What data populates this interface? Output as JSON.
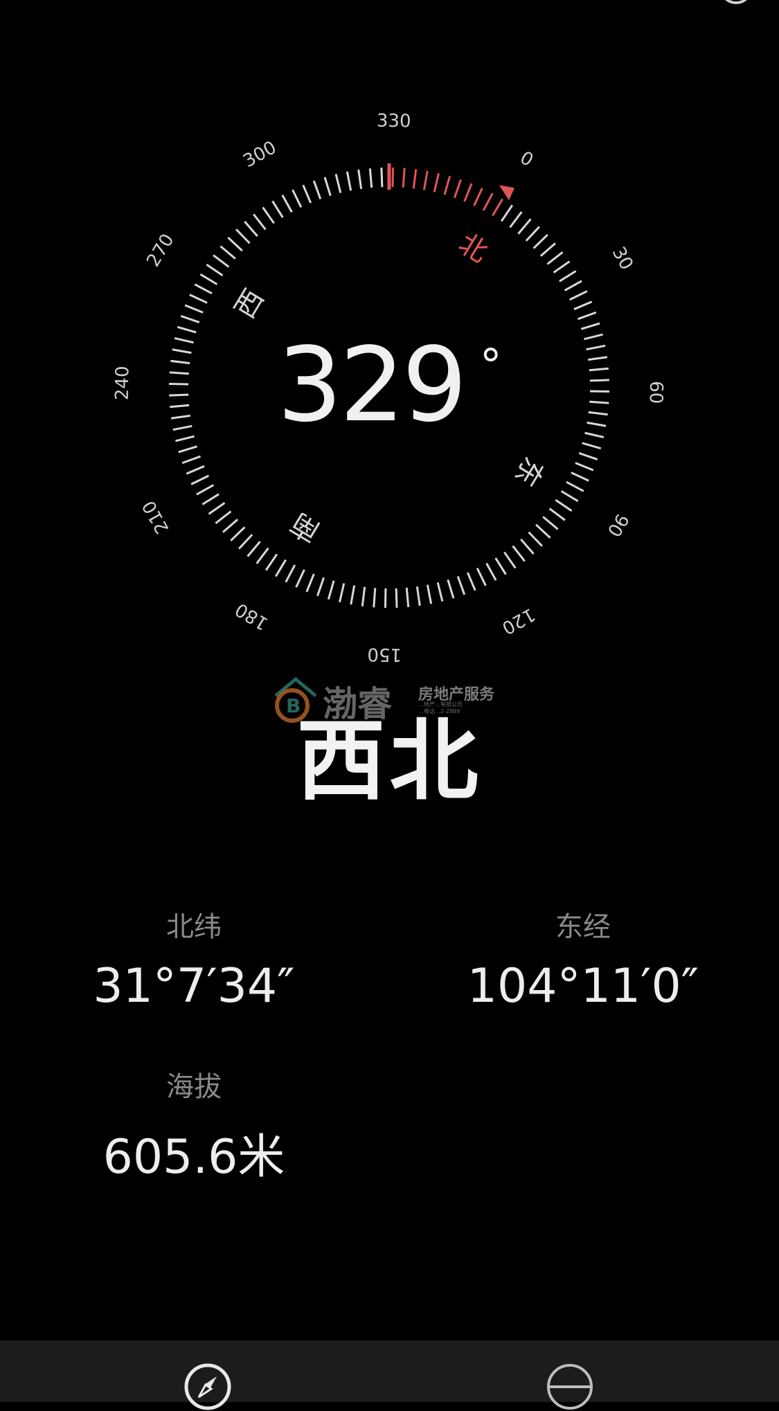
{
  "compass": {
    "heading_value": "329",
    "heading_unit": "°",
    "direction_label": "西北",
    "cardinals": {
      "north": "北",
      "east": "东",
      "south": "南",
      "west": "西"
    },
    "dial_numbers": [
      "0",
      "30",
      "60",
      "90",
      "120",
      "150",
      "180",
      "210",
      "240",
      "270",
      "300",
      "330"
    ],
    "accent_color": "#e25555"
  },
  "watermark": {
    "name": "渤睿",
    "service": "房地产服务",
    "line1": "…地产…有限公司",
    "line2": "…电话…2-2889"
  },
  "coordinates": {
    "latitude_label": "北纬",
    "latitude_value": "31°7′34″",
    "longitude_label": "东经",
    "longitude_value": "104°11′0″",
    "altitude_label": "海拔",
    "altitude_value": "605.6米"
  },
  "toolbar": {
    "icons": [
      "settings-gear-icon"
    ],
    "tabs": [
      {
        "icon": "compass-icon"
      },
      {
        "icon": "level-icon"
      }
    ]
  }
}
